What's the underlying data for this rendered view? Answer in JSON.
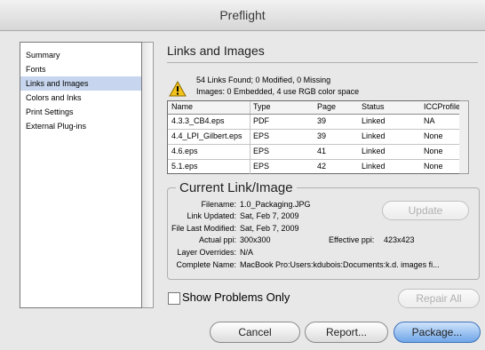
{
  "window": {
    "title": "Preflight"
  },
  "sidebar": {
    "items": [
      {
        "label": "Summary"
      },
      {
        "label": "Fonts"
      },
      {
        "label": "Links and Images"
      },
      {
        "label": "Colors and Inks"
      },
      {
        "label": "Print Settings"
      },
      {
        "label": "External Plug-ins"
      }
    ],
    "selected": "Links and Images"
  },
  "links": {
    "title": "Links and Images",
    "summary_line1": "54 Links Found; 0 Modified, 0 Missing",
    "summary_line2": "Images: 0 Embedded, 4 use RGB color space",
    "warning_icon": "warning-triangle-icon",
    "table": {
      "headers": [
        "Name",
        "Type",
        "Page",
        "Status",
        "ICCProfile"
      ],
      "rows": [
        [
          "4.3.3_CB4.eps",
          "PDF",
          "39",
          "Linked",
          "NA"
        ],
        [
          "4.4_LPI_Gilbert.eps",
          "EPS",
          "39",
          "Linked",
          "None"
        ],
        [
          "4.6.eps",
          "EPS",
          "41",
          "Linked",
          "None"
        ],
        [
          "5.1.eps",
          "EPS",
          "42",
          "Linked",
          "None"
        ]
      ]
    }
  },
  "current": {
    "title": "Current Link/Image",
    "filename_label": "Filename:",
    "filename": "1.0_Packaging.JPG",
    "updated_label": "Link Updated:",
    "updated": "Sat, Feb 7, 2009",
    "modified_label": "File Last Modified:",
    "modified": "Sat, Feb 7, 2009",
    "actual_ppi_label": "Actual ppi:",
    "actual_ppi": "300x300",
    "effective_ppi_label": "Effective ppi:",
    "effective_ppi": "423x423",
    "overrides_label": "Layer Overrides:",
    "overrides": "N/A",
    "complete_label": "Complete Name:",
    "complete": "MacBook Pro:Users:kdubois:Documents:k.d. images fi..."
  },
  "buttons": {
    "update": "Update",
    "repair_all": "Repair All",
    "cancel": "Cancel",
    "report": "Report...",
    "package": "Package..."
  },
  "options": {
    "show_problems_only": "Show Problems Only",
    "show_problems_checked": false
  },
  "colors": {
    "accent": "#6fa6e8",
    "selection": "#c7d6ee",
    "warning": "#f2c21a"
  }
}
